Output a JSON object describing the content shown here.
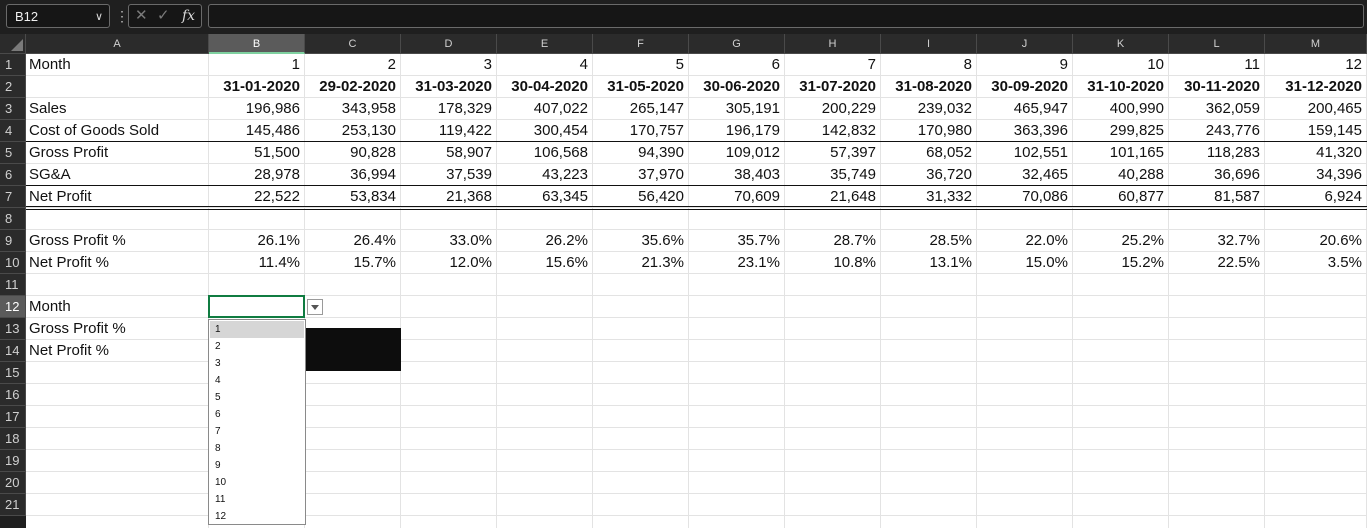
{
  "formula_bar": {
    "name_box": "B12",
    "cancel_glyph": "✕",
    "enter_glyph": "✓",
    "fx_label": "fx",
    "formula": ""
  },
  "columns": [
    "A",
    "B",
    "C",
    "D",
    "E",
    "F",
    "G",
    "H",
    "I",
    "J",
    "K",
    "L",
    "M"
  ],
  "rows": [
    "1",
    "2",
    "3",
    "4",
    "5",
    "6",
    "7",
    "8",
    "9",
    "10",
    "11",
    "12",
    "13",
    "14",
    "15",
    "16",
    "17",
    "18",
    "19",
    "20",
    "21"
  ],
  "selected": {
    "column": "B",
    "row": "12"
  },
  "cells": {
    "r1": {
      "A": "Month",
      "values": [
        "1",
        "2",
        "3",
        "4",
        "5",
        "6",
        "7",
        "8",
        "9",
        "10",
        "11",
        "12"
      ]
    },
    "r2": {
      "values": [
        "31-01-2020",
        "29-02-2020",
        "31-03-2020",
        "30-04-2020",
        "31-05-2020",
        "30-06-2020",
        "31-07-2020",
        "31-08-2020",
        "30-09-2020",
        "31-10-2020",
        "30-11-2020",
        "31-12-2020"
      ]
    },
    "r3": {
      "A": "Sales",
      "values": [
        "196,986",
        "343,958",
        "178,329",
        "407,022",
        "265,147",
        "305,191",
        "200,229",
        "239,032",
        "465,947",
        "400,990",
        "362,059",
        "200,465"
      ]
    },
    "r4": {
      "A": "Cost of Goods Sold",
      "values": [
        "145,486",
        "253,130",
        "119,422",
        "300,454",
        "170,757",
        "196,179",
        "142,832",
        "170,980",
        "363,396",
        "299,825",
        "243,776",
        "159,145"
      ]
    },
    "r5": {
      "A": "Gross Profit",
      "values": [
        "51,500",
        "90,828",
        "58,907",
        "106,568",
        "94,390",
        "109,012",
        "57,397",
        "68,052",
        "102,551",
        "101,165",
        "118,283",
        "41,320"
      ]
    },
    "r6": {
      "A": "SG&A",
      "values": [
        "28,978",
        "36,994",
        "37,539",
        "43,223",
        "37,970",
        "38,403",
        "35,749",
        "36,720",
        "32,465",
        "40,288",
        "36,696",
        "34,396"
      ]
    },
    "r7": {
      "A": "Net Profit",
      "values": [
        "22,522",
        "53,834",
        "21,368",
        "63,345",
        "56,420",
        "70,609",
        "21,648",
        "31,332",
        "70,086",
        "60,877",
        "81,587",
        "6,924"
      ]
    },
    "r9": {
      "A": "Gross Profit %",
      "values": [
        "26.1%",
        "26.4%",
        "33.0%",
        "26.2%",
        "35.6%",
        "35.7%",
        "28.7%",
        "28.5%",
        "22.0%",
        "25.2%",
        "32.7%",
        "20.6%"
      ]
    },
    "r10": {
      "A": "Net Profit %",
      "values": [
        "11.4%",
        "15.7%",
        "12.0%",
        "15.6%",
        "21.3%",
        "23.1%",
        "10.8%",
        "13.1%",
        "15.0%",
        "15.2%",
        "22.5%",
        "3.5%"
      ]
    },
    "r12": {
      "A": "Month"
    },
    "r13": {
      "A": "Gross Profit %"
    },
    "r14": {
      "A": "Net Profit %"
    }
  },
  "dropdown": {
    "options": [
      "1",
      "2",
      "3",
      "4",
      "5",
      "6",
      "7",
      "8",
      "9",
      "10",
      "11",
      "12"
    ],
    "highlighted": "1"
  },
  "colors": {
    "selection_accent": "#107c41",
    "header_bg": "#2b2b2b",
    "selected_header_bg": "#5b5b5b"
  }
}
